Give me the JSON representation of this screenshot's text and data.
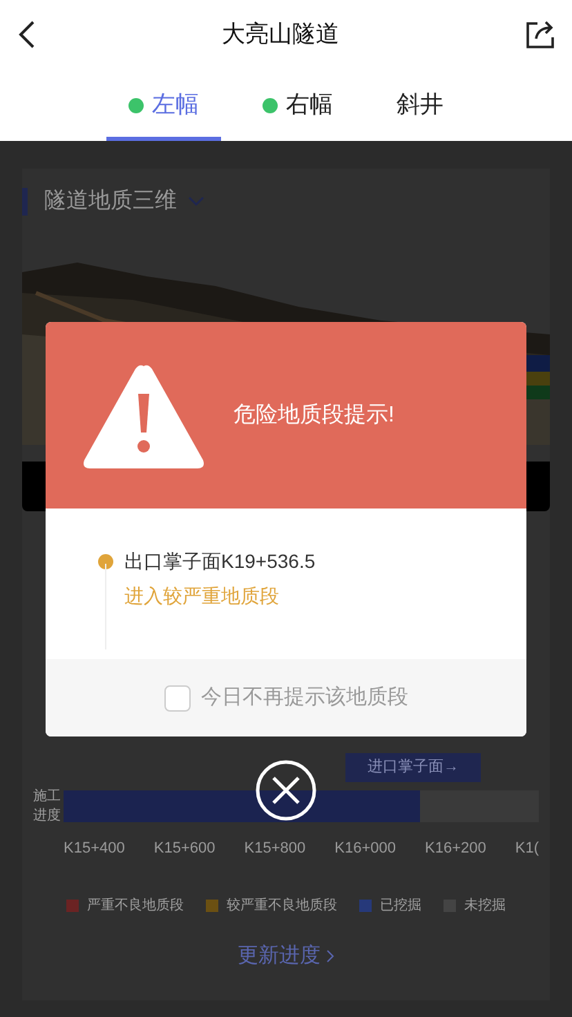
{
  "header": {
    "title": "大亮山隧道"
  },
  "tabs": [
    {
      "label": "左幅",
      "selected": true,
      "dot": true
    },
    {
      "label": "右幅",
      "selected": false,
      "dot": true
    },
    {
      "label": "斜井",
      "selected": false,
      "dot": false
    }
  ],
  "section": {
    "title": "隧道地质三维"
  },
  "progress": {
    "label": "施工进度",
    "marker": "进口掌子面→",
    "level": 0.75,
    "ticks": [
      "K15+400",
      "K15+600",
      "K15+800",
      "K16+000",
      "K16+200",
      "K1("
    ]
  },
  "legend": [
    {
      "label": "严重不良地质段",
      "color": "#6b2323"
    },
    {
      "label": "较严重不良地质段",
      "color": "#6b5012"
    },
    {
      "label": "已挖掘",
      "color": "#26397a"
    },
    {
      "label": "未挖掘",
      "color": "#444444"
    }
  ],
  "update_link": "更新进度",
  "modal": {
    "title": "危险地质段提示!",
    "location": "出口掌子面K19+536.5",
    "message": "进入较严重地质段",
    "checkbox": {
      "label": "今日不再提示该地质段",
      "checked": false
    }
  }
}
